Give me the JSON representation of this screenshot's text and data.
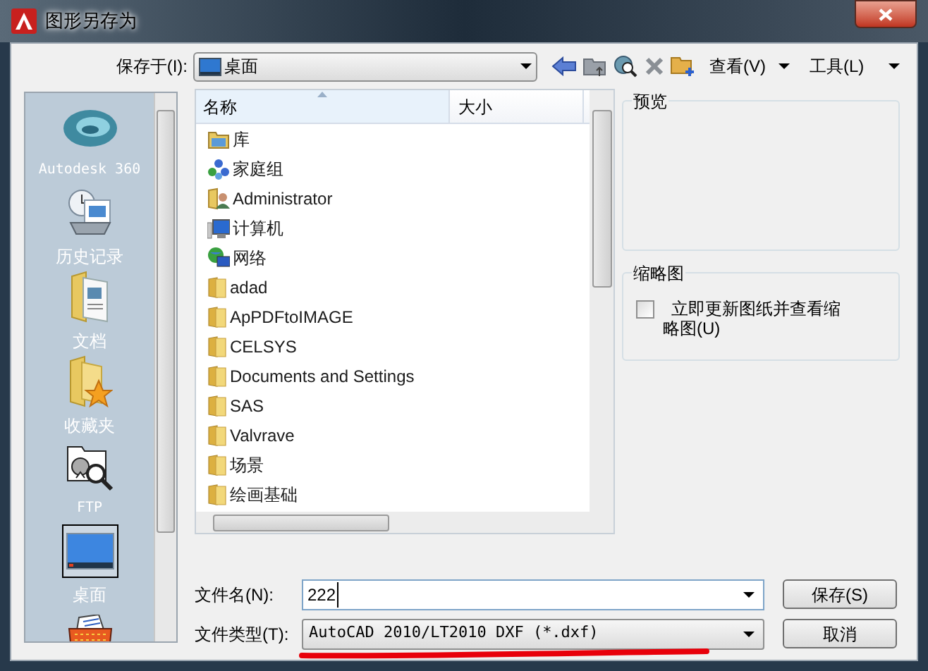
{
  "window": {
    "title": "图形另存为"
  },
  "save_in": {
    "label": "保存于(I):",
    "value": "桌面"
  },
  "toolbar": {
    "view": "查看(V)",
    "tools": "工具(L)"
  },
  "places": [
    {
      "label": "Autodesk 360",
      "kind": "cloud",
      "selected": false
    },
    {
      "label": "历史记录",
      "kind": "history",
      "selected": false
    },
    {
      "label": "文档",
      "kind": "documents",
      "selected": false
    },
    {
      "label": "收藏夹",
      "kind": "favorites",
      "selected": false
    },
    {
      "label": "FTP",
      "kind": "ftp",
      "selected": false
    },
    {
      "label": "桌面",
      "kind": "desktop",
      "selected": true
    },
    {
      "kind": "buzzsaw",
      "selected": false
    }
  ],
  "file_list": {
    "columns": [
      "名称",
      "大小"
    ],
    "items": [
      {
        "name": "库",
        "kind": "library"
      },
      {
        "name": "家庭组",
        "kind": "homegroup"
      },
      {
        "name": "Administrator",
        "kind": "user"
      },
      {
        "name": "计算机",
        "kind": "computer"
      },
      {
        "name": "网络",
        "kind": "network"
      },
      {
        "name": "adad",
        "kind": "folder"
      },
      {
        "name": "ApPDFtoIMAGE",
        "kind": "folder"
      },
      {
        "name": "CELSYS",
        "kind": "folder"
      },
      {
        "name": "Documents and Settings",
        "kind": "folder"
      },
      {
        "name": "SAS",
        "kind": "folder"
      },
      {
        "name": "Valvrave",
        "kind": "folder"
      },
      {
        "name": "场景",
        "kind": "folder"
      },
      {
        "name": "绘画基础",
        "kind": "folder"
      }
    ]
  },
  "preview": {
    "title": "预览"
  },
  "thumbnail": {
    "title": "缩略图",
    "checkbox": {
      "label": "立即更新图纸并查看缩略图(U)",
      "checked": false
    }
  },
  "file_name": {
    "label": "文件名(N):",
    "value": "222"
  },
  "file_type": {
    "label": "文件类型(T):",
    "value": "AutoCAD 2010/LT2010 DXF (*.dxf)"
  },
  "buttons": [
    "保存(S)",
    "取消"
  ]
}
